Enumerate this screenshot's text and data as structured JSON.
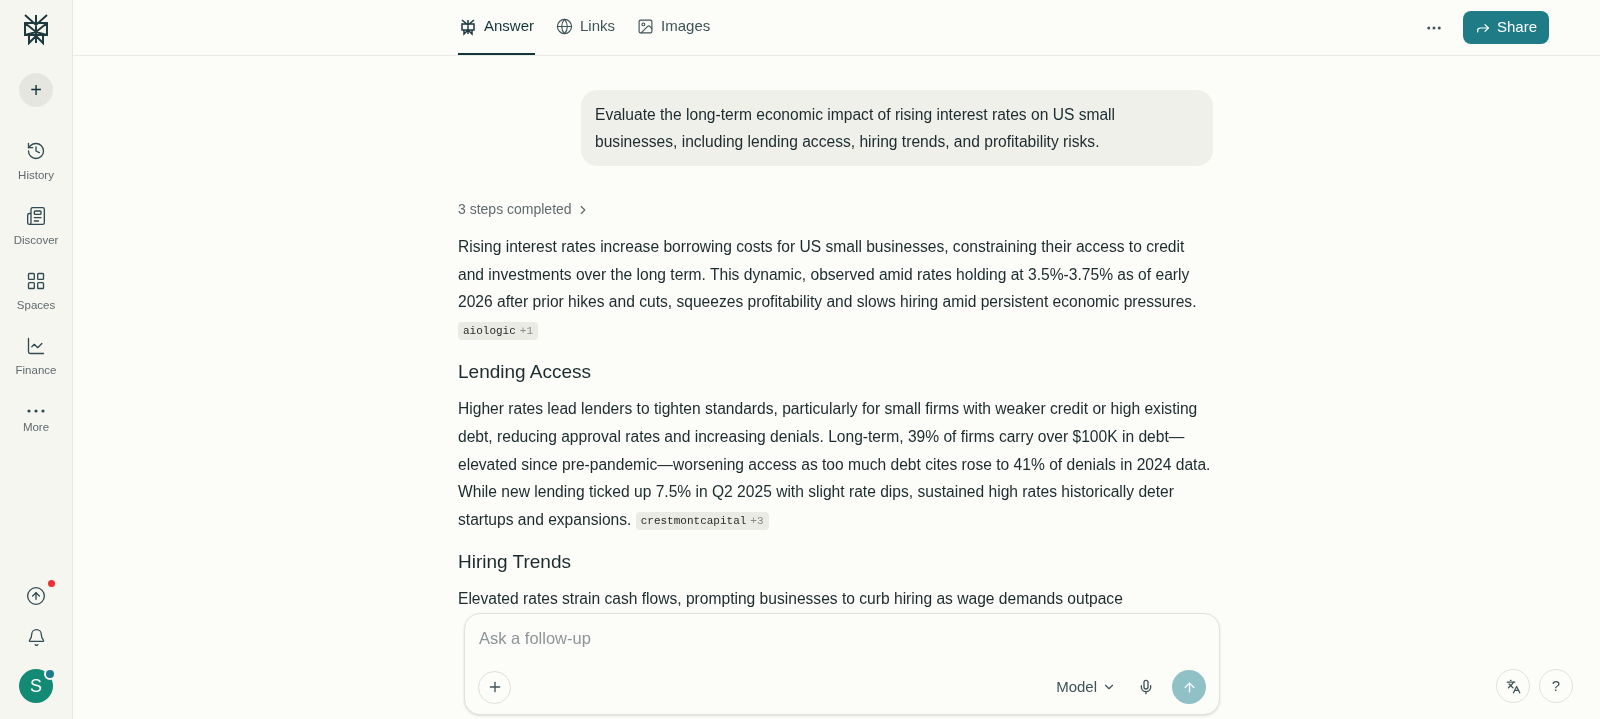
{
  "sidebar": {
    "new_button": "+",
    "items": [
      {
        "kind": "history",
        "label": "History",
        "selected": false
      },
      {
        "kind": "discover",
        "label": "Discover",
        "selected": false
      },
      {
        "kind": "spaces",
        "label": "Spaces",
        "selected": false
      },
      {
        "kind": "finance",
        "label": "Finance",
        "selected": false
      },
      {
        "kind": "more",
        "label": "More",
        "selected": false
      }
    ],
    "upgrade": {
      "notification_dot": true
    },
    "avatar": {
      "initial": "S",
      "status_dot": true
    }
  },
  "tabs": [
    {
      "kind": "answer",
      "label": "Answer",
      "selected": true
    },
    {
      "kind": "links",
      "label": "Links",
      "selected": false
    },
    {
      "kind": "images",
      "label": "Images",
      "selected": false
    }
  ],
  "share_button": "Share",
  "query": "Evaluate the long-term economic impact of rising interest rates on US small businesses, including lending access, hiring trends, and profitability risks.",
  "steps": "3 steps completed",
  "blocks": [
    {
      "kind": "paragraph",
      "text": "Rising interest rates increase borrowing costs for US small businesses, constraining their access to credit and investments over the long term. This dynamic, observed amid rates holding at 3.5%-3.75% as of early 2026 after prior hikes and cuts, squeezes profitability and slows hiring amid persistent economic pressures.",
      "source": {
        "name": "aiologic",
        "count": "+1"
      }
    },
    {
      "kind": "heading",
      "text": "Lending Access"
    },
    {
      "kind": "paragraph",
      "text": "Higher rates lead lenders to tighten standards, particularly for small firms with weaker credit or high existing debt, reducing approval rates and increasing denials. Long-term, 39% of firms carry over $100K in debt—elevated since pre-pandemic—worsening access as too much debt cites rose to 41% of denials in 2024 data. While new lending ticked up 7.5% in Q2 2025 with slight rate dips, sustained high rates historically deter startups and expansions.",
      "source": {
        "name": "crestmontcapital",
        "count": "+3"
      }
    },
    {
      "kind": "heading",
      "text": "Hiring Trends"
    },
    {
      "kind": "paragraph",
      "text": "Elevated rates strain cash flows, prompting businesses to curb hiring as wage demands outpace"
    }
  ],
  "composer": {
    "placeholder": "Ask a follow-up",
    "model": "Model"
  },
  "help_button": "?"
}
